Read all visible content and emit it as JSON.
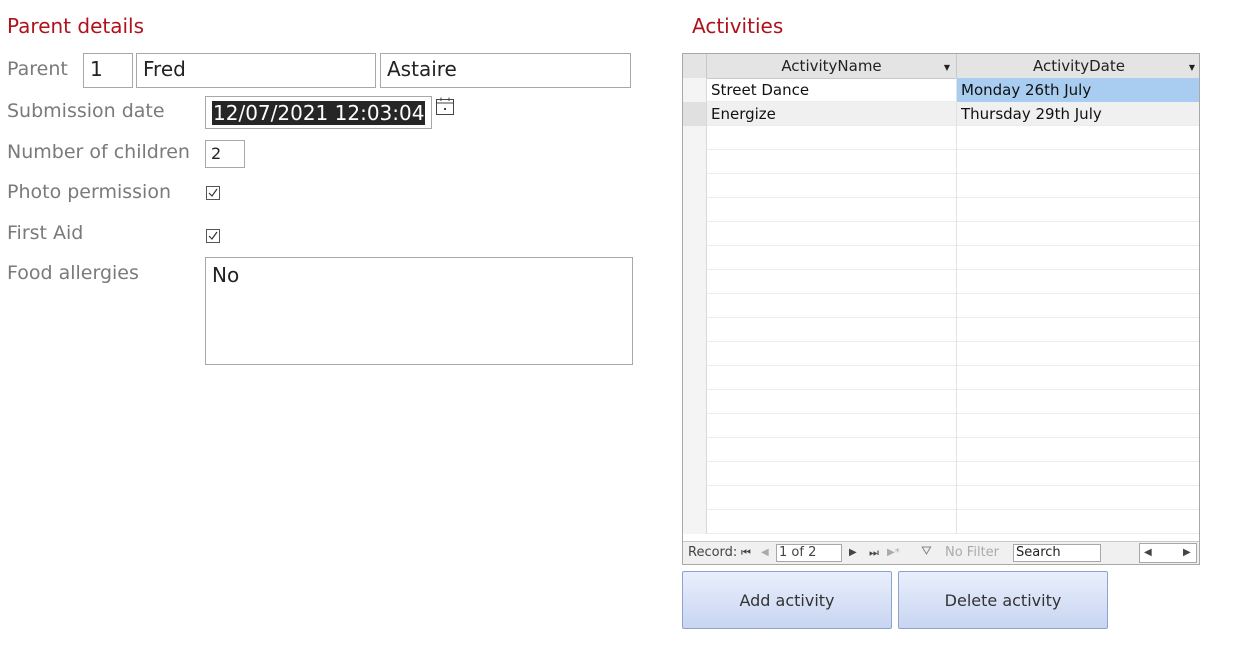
{
  "parent_section": {
    "title": "Parent details",
    "parent_label": "Parent",
    "parent_id": "1",
    "first_name": "Fred",
    "last_name": "Astaire",
    "submission_label": "Submission date",
    "submission_value": "12/07/2021 12:03:04",
    "children_label": "Number of children",
    "children_value": "2",
    "photo_label": "Photo permission",
    "photo_checked": true,
    "firstaid_label": "First Aid",
    "firstaid_checked": true,
    "allergies_label": "Food allergies",
    "allergies_value": "No"
  },
  "activities_section": {
    "title": "Activities",
    "columns": [
      "ActivityName",
      "ActivityDate"
    ],
    "rows": [
      {
        "name": "Street Dance",
        "date": "Monday 26th July"
      },
      {
        "name": "Energize",
        "date": "Thursday 29th July"
      }
    ],
    "nav": {
      "record_label": "Record:",
      "position": "1 of 2",
      "filter_label": "No Filter",
      "search_label": "Search"
    }
  },
  "buttons": {
    "add": "Add activity",
    "delete": "Delete activity"
  },
  "colors": {
    "accent_title": "#b0121b",
    "selected_cell": "#a9cdf0",
    "button_gradient_top": "#e9effc",
    "button_gradient_bottom": "#c8d5f1"
  }
}
